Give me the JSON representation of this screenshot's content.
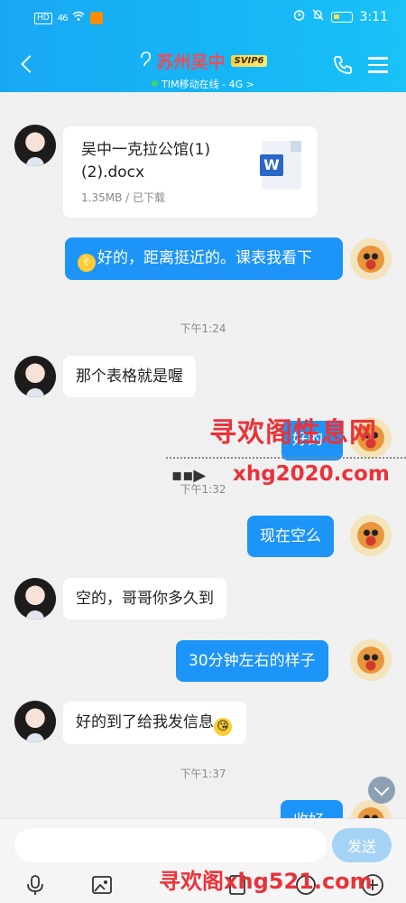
{
  "status": {
    "signal": "46",
    "time": "3:11"
  },
  "header": {
    "title": "苏州吴中",
    "badge": "SVIP6",
    "subtitle": "TIM移动在线 - 4G >"
  },
  "messages": {
    "file": {
      "name": "吴中一克拉公馆(1)(2).docx",
      "meta": "1.35MB / 已下载",
      "icon_letter": "W"
    },
    "m1": "好的，距离挺近的。课表我看下",
    "t1": "下午1:24",
    "m2": "那个表格就是喔",
    "m3": "好的",
    "t2": "下午1:32",
    "m4": "现在空么",
    "m5": "空的，哥哥你多久到",
    "m6": "30分钟左右的样子",
    "m7": "好的到了给我发信息",
    "t3": "下午1:37",
    "m8": "收好"
  },
  "watermarks": {
    "w1": "寻欢阁性息网",
    "w2": "xhg2020.com",
    "w3": "寻欢阁xhg521.com"
  },
  "input": {
    "placeholder": "",
    "send_label": "发送"
  },
  "colors": {
    "header": "#16b7f6",
    "bubble_out": "#1d94f7",
    "title": "#e94e5b"
  }
}
